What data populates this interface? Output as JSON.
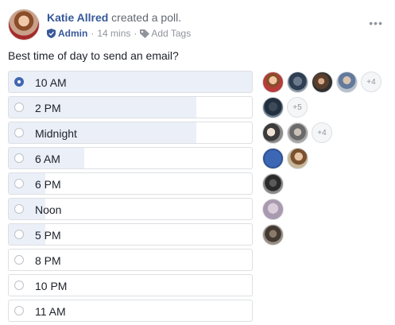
{
  "header": {
    "author": "Katie Allred",
    "action": "created a poll.",
    "role": "Admin",
    "time": "14 mins",
    "add_tags": "Add Tags",
    "more": "•••"
  },
  "poll": {
    "question": "Best time of day to send an email?",
    "options": [
      {
        "label": "10 AM",
        "checked": true,
        "fill": 1.0,
        "voters": [
          "v-a",
          "v-b",
          "v-c",
          "v-d"
        ],
        "more": "+4"
      },
      {
        "label": "2 PM",
        "checked": false,
        "fill": 0.77,
        "voters": [
          "v-e"
        ],
        "more": "+5"
      },
      {
        "label": "Midnight",
        "checked": false,
        "fill": 0.77,
        "voters": [
          "v-f",
          "v-g"
        ],
        "more": "+4"
      },
      {
        "label": "6 AM",
        "checked": false,
        "fill": 0.31,
        "voters": [
          "v-h",
          "v-i"
        ],
        "more": ""
      },
      {
        "label": "6 PM",
        "checked": false,
        "fill": 0.15,
        "voters": [
          "v-j"
        ],
        "more": ""
      },
      {
        "label": "Noon",
        "checked": false,
        "fill": 0.15,
        "voters": [
          "v-k"
        ],
        "more": ""
      },
      {
        "label": "5 PM",
        "checked": false,
        "fill": 0.15,
        "voters": [
          "v-l"
        ],
        "more": ""
      },
      {
        "label": "8 PM",
        "checked": false,
        "fill": 0,
        "voters": [],
        "more": ""
      },
      {
        "label": "10 PM",
        "checked": false,
        "fill": 0,
        "voters": [],
        "more": ""
      },
      {
        "label": "11 AM",
        "checked": false,
        "fill": 0,
        "voters": [],
        "more": ""
      }
    ]
  },
  "icons": {
    "shield": "shield-icon",
    "tag": "tag-icon",
    "more": "more-options-icon"
  },
  "colors": {
    "link": "#365899",
    "accent": "#4267b2",
    "fill": "#ebeff8",
    "border": "#dddfe2",
    "muted": "#90949c"
  }
}
